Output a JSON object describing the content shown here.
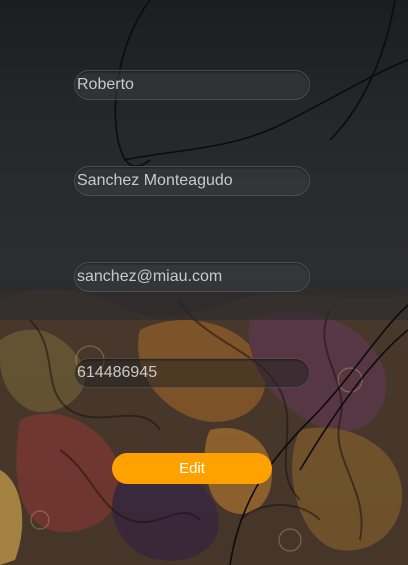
{
  "form": {
    "first_name": "Roberto",
    "last_name": "Sanchez Monteagudo",
    "email": "sanchez@miau.com",
    "phone": "614486945",
    "edit_label": "Edit"
  },
  "colors": {
    "background_dark": "#1f2022",
    "button_accent": "#ffa200",
    "field_text": "#c9c9c9"
  }
}
